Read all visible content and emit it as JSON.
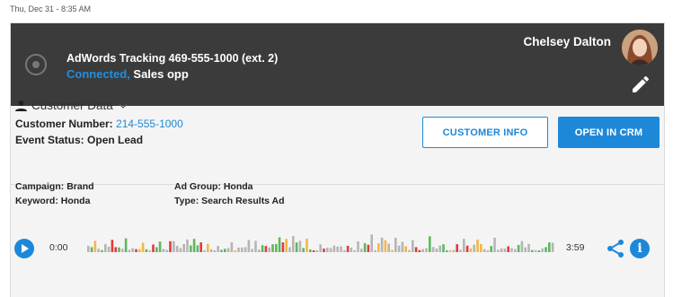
{
  "timestamp": "Thu, Dec 31 - 8:35 AM",
  "call": {
    "tracking_title": "AdWords Tracking 469-555-1000 (ext. 2)",
    "status": "Connected,",
    "status_detail": " Sales opp",
    "agent_name": "Chelsey Dalton"
  },
  "customer": {
    "section_label": "Customer Data",
    "number_label": "Customer Number:",
    "number_value": "214-555-1000",
    "event_label": "Event Status:",
    "event_value": "Open Lead"
  },
  "buttons": {
    "customer_info": "CUSTOMER INFO",
    "open_in_crm": "OPEN IN CRM"
  },
  "meta": {
    "campaign_label": "Campaign:",
    "campaign_value": "Brand",
    "keyword_label": "Keyword:",
    "keyword_value": "Honda",
    "ad_group_label": "Ad Group:",
    "ad_group_value": "Honda",
    "type_label": "Type:",
    "type_value": "Search Results Ad"
  },
  "player": {
    "time_start": "0:00",
    "time_end": "3:59"
  },
  "colors": {
    "accent": "#1e88d8",
    "header_bg": "#3b3b3b",
    "wave_gray": "#b5b5b5",
    "wave_green": "#5cb85c",
    "wave_orange": "#f5b642",
    "wave_red": "#e03c3c"
  },
  "icons": [
    "call-status-icon",
    "person-icon",
    "chevron-down-icon",
    "edit-icon",
    "play-icon",
    "share-icon",
    "info-icon"
  ]
}
